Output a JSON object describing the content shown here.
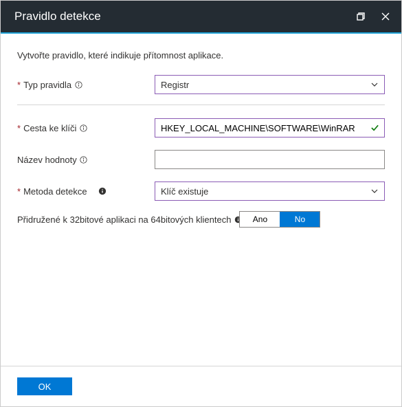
{
  "header": {
    "title": "Pravidlo detekce"
  },
  "subtitle": "Vytvořte pravidlo, které indikuje přítomnost aplikace.",
  "form": {
    "ruleTypeLabel": "Typ pravidla",
    "ruleTypeValue": "Registr",
    "keyPathLabel": "Cesta ke klíči",
    "keyPathValue": "HKEY_LOCAL_MACHINE\\SOFTWARE\\WinRAR",
    "valueNameLabel": "Název hodnoty",
    "valueNameValue": "",
    "methodLabel": "Metoda detekce",
    "methodValue": "Klíč existuje",
    "assocLabel": "Přidružené k 32bitové aplikaci na 64bitových klientech",
    "toggleYes": "Ano",
    "toggleNo": "No"
  },
  "footer": {
    "ok": "OK"
  }
}
